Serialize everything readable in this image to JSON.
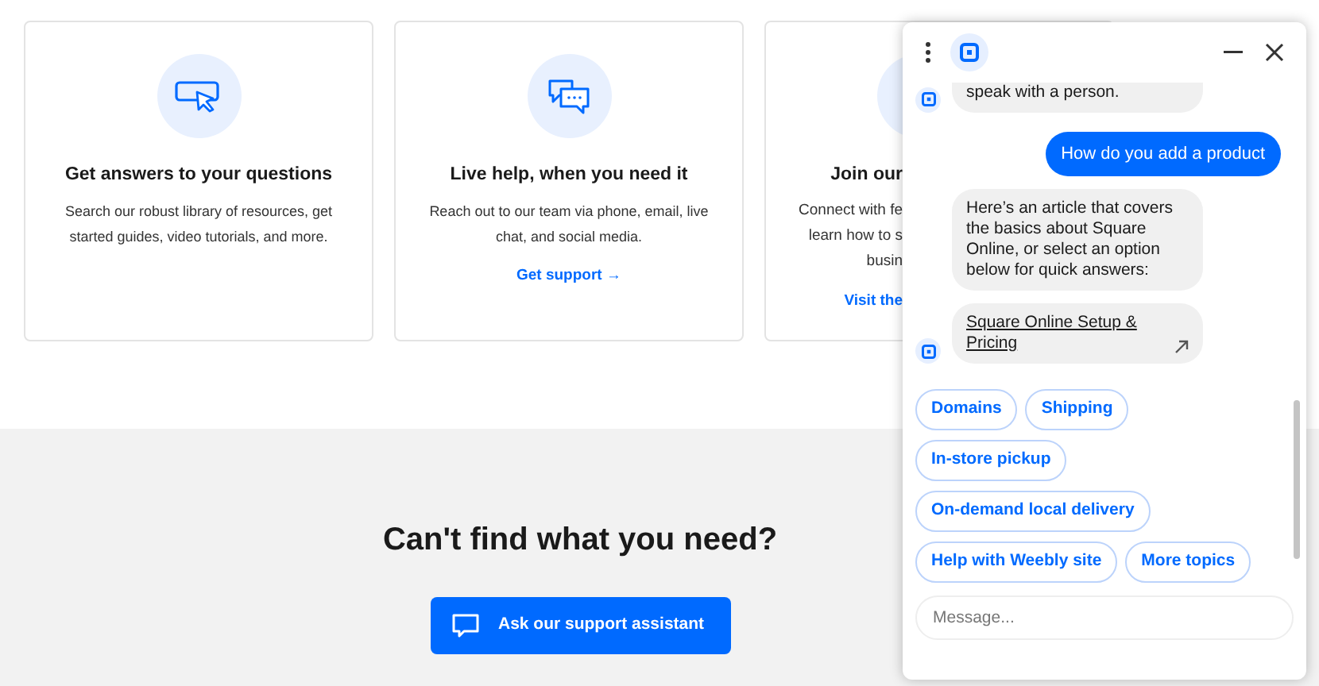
{
  "cards": [
    {
      "title": "Get answers to your questions",
      "text": "Search our robust library of resources, get started guides, video tutorials, and more."
    },
    {
      "title": "Live help, when you need it",
      "text": "Reach out to our team via phone, email, live chat, and social media.",
      "link": "Get support →"
    }
  ],
  "cut_card": {
    "title": "Join our",
    "lines": [
      "Connect with fe",
      "learn how to s",
      "busin"
    ],
    "link": "Visit the"
  },
  "banner": {
    "heading": "Can't find what you need?",
    "button": "Ask our support assistant"
  },
  "chat": {
    "messages": [
      {
        "kind": "bot",
        "text": "speak with a person."
      },
      {
        "kind": "user",
        "text": "How do you add a product"
      },
      {
        "kind": "bot",
        "text": "Here’s an article that covers the basics about Square Online, or select an option below for quick answers:"
      },
      {
        "kind": "link",
        "text": "Square Online Setup & Pricing"
      }
    ],
    "options": [
      [
        "Domains",
        "Shipping"
      ],
      [
        "In-store pickup"
      ],
      [
        "On-demand local delivery"
      ],
      [
        "Help with Weebly site",
        "More topics"
      ]
    ],
    "input": {
      "placeholder": "Message..."
    }
  }
}
